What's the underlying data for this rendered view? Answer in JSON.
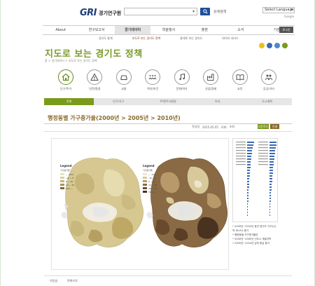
{
  "header": {
    "logo_mark": "GRI",
    "logo_text": "경기연구원",
    "search_placeholder": "",
    "search_button": "🔍",
    "advanced_search": "상세검색",
    "language": "Select Language",
    "powered_by": "Google"
  },
  "nav": {
    "items": [
      "About",
      "연구보고서",
      "경기데이터",
      "학술행사",
      "출판",
      "소식",
      "기관"
    ],
    "active": 2,
    "login": "로그인",
    "sub_items": [
      "경기도 통계",
      "지도로 보는 경기도 정책",
      "통계로 보는 경기도",
      "데이터 서비스"
    ],
    "sub_active": 1
  },
  "page": {
    "title": "지도로 보는 경기도 정책",
    "subtitle": "홈 > 경기데이터 > 지도로 보는 경기도 정책"
  },
  "dots": [
    "#e8c020",
    "#3a6ab0",
    "#4a8ad0",
    "#7a9a1a"
  ],
  "categories": [
    {
      "label": "인구/주거",
      "icon": "home-icon"
    },
    {
      "label": "안전/환경",
      "icon": "warning-icon"
    },
    {
      "label": "교통",
      "icon": "car-icon"
    },
    {
      "label": "복지/보건",
      "icon": "people-icon"
    },
    {
      "label": "문화/여가",
      "icon": "music-icon"
    },
    {
      "label": "산업/경제",
      "icon": "factory-icon"
    },
    {
      "label": "교육",
      "icon": "book-icon"
    },
    {
      "label": "공공/기타",
      "icon": "group-icon"
    }
  ],
  "tabs": [
    "전체",
    "인구/가구",
    "주택/주거환경",
    "토지",
    "도시계획"
  ],
  "tab_active": 0,
  "section": {
    "title": "행정동별 가구증가율(2000년 > 2005년 > 2010년)",
    "date_label": "작성일",
    "date": "2015.05.05",
    "views": "430",
    "views_label": "조회",
    "btn_download": "다운로드",
    "btn_print": "인쇄",
    "btn_download_color": "#7a9a1a",
    "btn_print_color": "#8a6a2a"
  },
  "legend_left": {
    "title": "Legend",
    "subtitle": "가구증가율",
    "items": [
      "~ -10%",
      "-10 ~ 0",
      "0 ~ 10",
      "10 ~ 30",
      "30% ~"
    ],
    "colors": [
      "#ece3c0",
      "#ddd09a",
      "#c7b677",
      "#aa9258",
      "#7d6a3c"
    ]
  },
  "legend_right": {
    "title": "Legend",
    "subtitle": "가구증가율",
    "items": [
      "~ -10%",
      "-10 ~ 0",
      "0 ~ 10",
      "10 ~ 30",
      "30 ~ 50",
      "50% ~"
    ],
    "colors": [
      "#ede6cc",
      "#d8c99a",
      "#b89a6a",
      "#8d6a44",
      "#6a4a2c",
      "#4a3220"
    ]
  },
  "side_notes": [
    "• 2000년~2010년 동안 경기도 가구수는 약 36.0% 증가",
    "• 행정동별 가구증가율은",
    "• 2000년~2005년 신도시 개발지역",
    "• 2005년~2010년 남부 중심 증가"
  ],
  "footer": [
    "이전글",
    "목록으로"
  ]
}
